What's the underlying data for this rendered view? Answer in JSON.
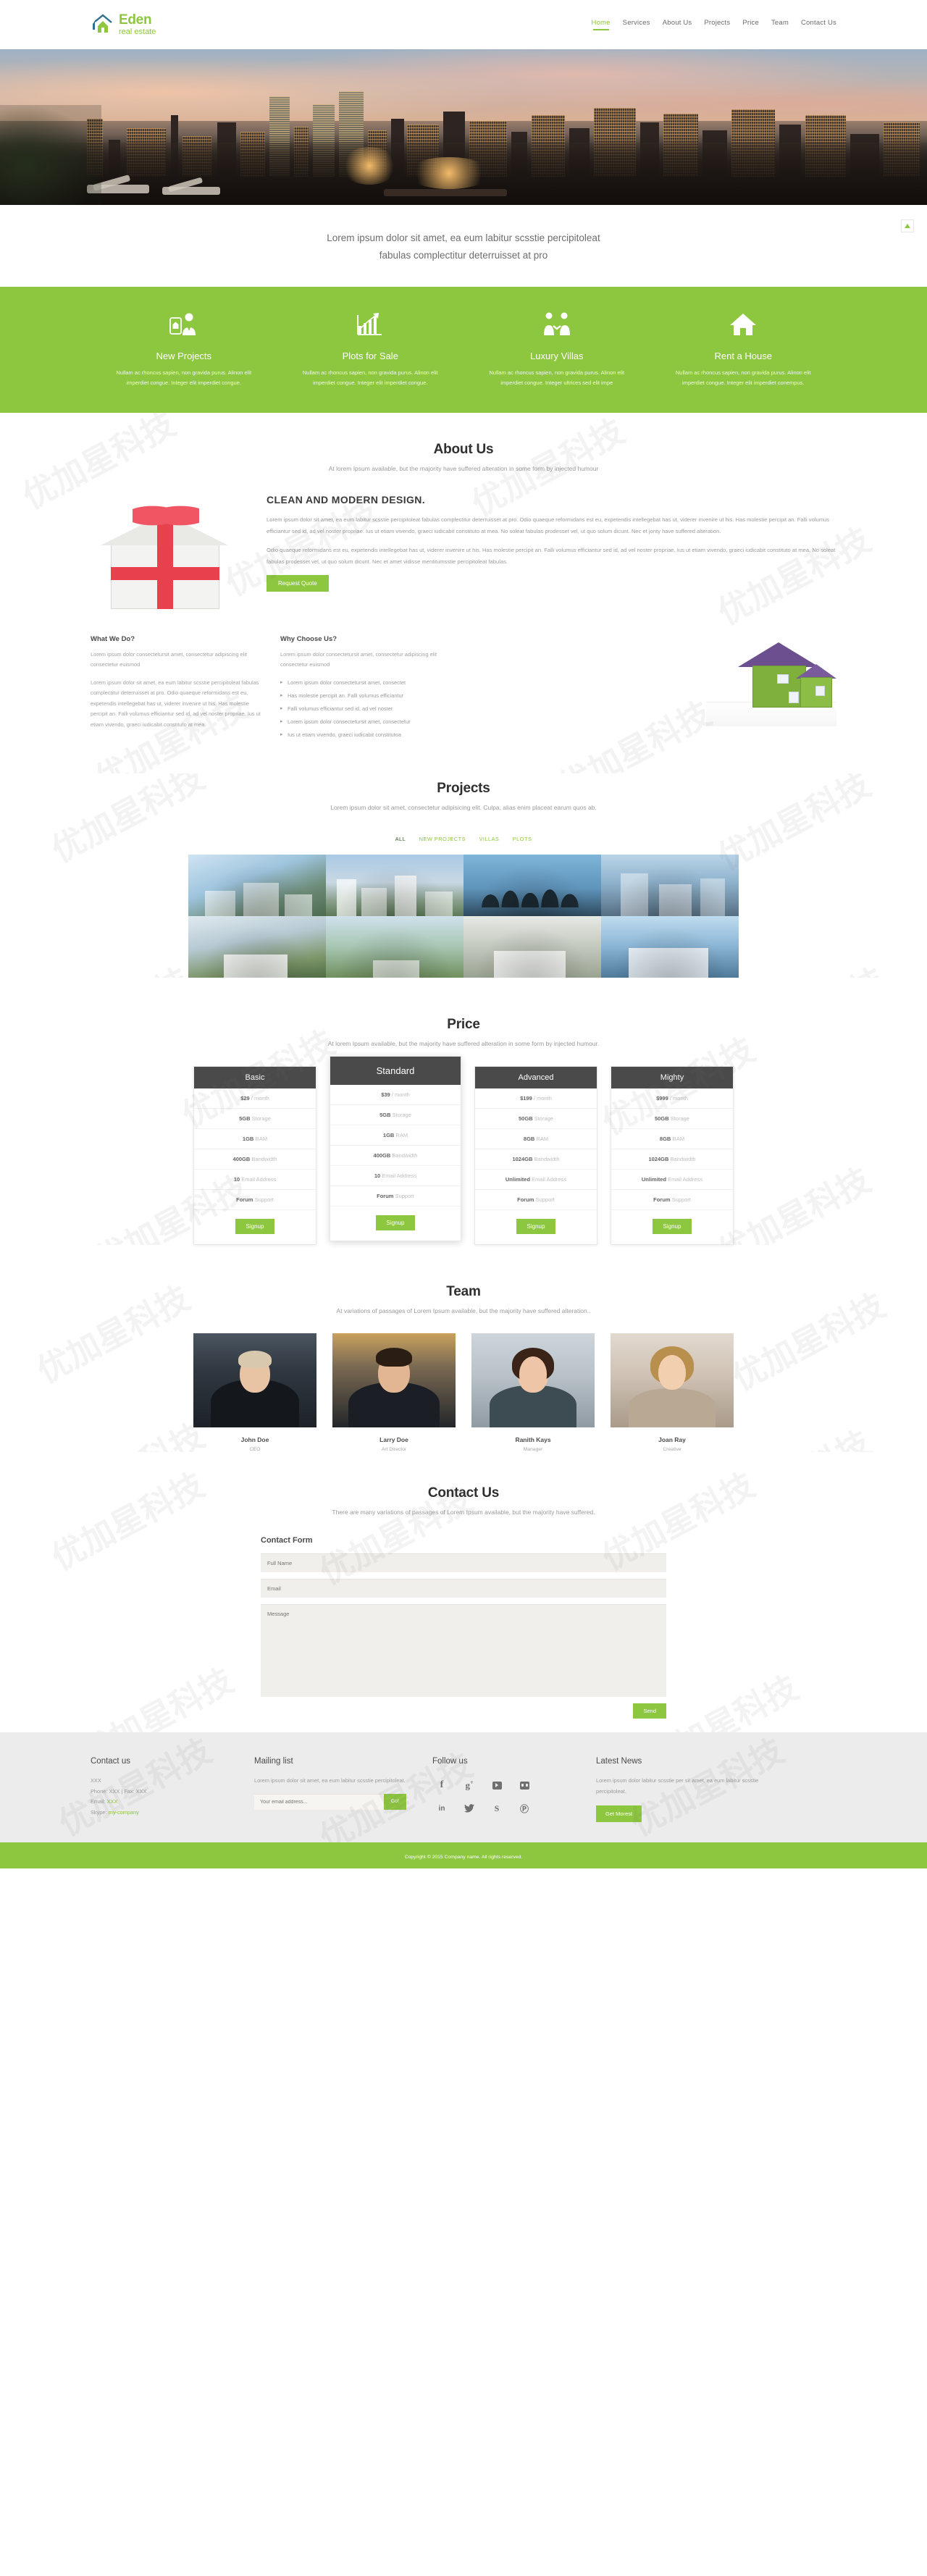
{
  "brand": {
    "name": "Eden",
    "tagline": "real estate",
    "color": "#8dc63f"
  },
  "nav": [
    {
      "label": "Home",
      "active": true
    },
    {
      "label": "Services",
      "active": false
    },
    {
      "label": "About Us",
      "active": false
    },
    {
      "label": "Projects",
      "active": false
    },
    {
      "label": "Price",
      "active": false
    },
    {
      "label": "Team",
      "active": false
    },
    {
      "label": "Contact Us",
      "active": false
    }
  ],
  "hero": {
    "alt": "city skyline at dusk seen from a rooftop terrace"
  },
  "tagline": {
    "line1": "Lorem ipsum dolor sit amet, ea eum labitur scsstie percipitoleat",
    "line2": "fabulas complectitur deterruisset at pro"
  },
  "services": [
    {
      "icon": "agent-icon",
      "title": "New Projects",
      "text": "Nullam ac rhoncus sapien, non gravida purus. Alinon elit imperdiet congue. Integer elit imperdiet congue."
    },
    {
      "icon": "chart-growth-icon",
      "title": "Plots for Sale",
      "text": "Nullam ac rhoncus sapien, non gravida purus. Alinon elit imperdiet congue. Integer elit imperdiet congue."
    },
    {
      "icon": "handshake-icon",
      "title": "Luxury Villas",
      "text": "Nullam ac rhoncus sapien, non gravida purus. Alinon elit imperdiet congue. Integer ultrices sed elit impe"
    },
    {
      "icon": "home-icon",
      "title": "Rent a House",
      "text": "Nullam ac rhoncus sapien, non gravida purus. Alinon elit imperdiet congue. Integer elit imperdiet conempus."
    }
  ],
  "about": {
    "title": "About Us",
    "subtitle": "At lorem Ipsum available, but the majority have suffered alteration in some form by injected humour",
    "heading": "CLEAN AND MODERN DESIGN.",
    "p1": "Lorem ipsum dolor sit amet, ea eum labitur scsstie percipitoleat fabulas complectitur deterruisset at pro. Odio quaeque reformidans est eu, expetendis intellegebat has ut, viderer invenire ut his. Has molestie percipit an. Falli volumus efficiantur sed id, ad vel noster propriae. Ius ut etiam vivendo, graeci iudicabit constituto at mea. No soleat fabulas prodesset vel, ut quo solum dicunt. Nec et jonty have suffered alteration.",
    "p2": "Odio quaeque reformidans est eu, expetendis intellegebat has ut, viderer invenire ut his. Has molestie percipit an. Falli volumus efficiantur sed id, ad vel noster propriae. Ius ut etiam vivendo, graeci iudicabit constituto at mea. No soleat fabulas prodesset vel, ut quo solum dicunt. Nec et amet vidisse mentitumsstie percipitoleat fabulas.",
    "cta": "Request Quote",
    "what_we_do": {
      "title": "What We Do?",
      "lead": "Lorem ipsum dolor consectetursit amet, consectetur adipiscing elit consectetur euismod",
      "body": "Lorem ipsum dolor sit amet, ea eum labitur scsstie percipitoleat fabulas complectitur deterruisset at pro. Odio quaeque reformidans est eu, expetendis intellegebat has ut, viderer invenire ut his. Has molestie percipit an. Falli volumus efficiantur sed id, ad vel noster propriae. Ius ut etiam vivendo, graeci iudicabit constituto at mea."
    },
    "why_choose": {
      "title": "Why Choose Us?",
      "lead": "Lorem ipsum dolor consectetursit amet, consectetur adipiscing elit consectetur euismod",
      "items": [
        "Lorem ipsum dolor consectetursit amet, consectet",
        "Has molestie percipit an. Falli volumus efficiantur",
        "Falli volumus efficiantur sed id, ad vel noster",
        "Lorem ipsum dolor consectetursit amet, consectetur",
        "Ius ut etiam vivendo, graeci iudicabit constitutoa"
      ]
    }
  },
  "projects": {
    "title": "Projects",
    "subtitle": "Lorem ipsum dolor sit amet, consectetur adipisicing elit. Culpa, alias enim placeat earum quos ab.",
    "filters": [
      {
        "label": "ALL",
        "active": true
      },
      {
        "label": "NEW PROJECTS",
        "active": false
      },
      {
        "label": "VILLAS",
        "active": false
      },
      {
        "label": "PLOTS",
        "active": false
      }
    ],
    "items": [
      {
        "alt": "modern white apartment complex"
      },
      {
        "alt": "city high-rise towers"
      },
      {
        "alt": "silhouette of people jumping at sunset"
      },
      {
        "alt": "glass skyscrapers"
      },
      {
        "alt": "suburban house with lawn"
      },
      {
        "alt": "green field plot"
      },
      {
        "alt": "grey suburban home"
      },
      {
        "alt": "blue siding family house"
      }
    ]
  },
  "price": {
    "title": "Price",
    "subtitle": "At lorem Ipsum available, but the majority have suffered alteration in some form by injected humour.",
    "plans": [
      {
        "name": "Basic",
        "featured": false,
        "signup": "Signup",
        "features": [
          {
            "value": "$29",
            "label": "/ month"
          },
          {
            "value": "5GB",
            "label": "Storage"
          },
          {
            "value": "1GB",
            "label": "RAM"
          },
          {
            "value": "400GB",
            "label": "Bandwidth"
          },
          {
            "value": "10",
            "label": "Email Address"
          },
          {
            "value": "Forum",
            "label": "Support"
          }
        ]
      },
      {
        "name": "Standard",
        "featured": true,
        "signup": "Signup",
        "features": [
          {
            "value": "$39",
            "label": "/ month"
          },
          {
            "value": "5GB",
            "label": "Storage"
          },
          {
            "value": "1GB",
            "label": "RAM"
          },
          {
            "value": "400GB",
            "label": "Bandwidth"
          },
          {
            "value": "10",
            "label": "Email Address"
          },
          {
            "value": "Forum",
            "label": "Support"
          }
        ]
      },
      {
        "name": "Advanced",
        "featured": false,
        "signup": "Signup",
        "features": [
          {
            "value": "$199",
            "label": "/ month"
          },
          {
            "value": "50GB",
            "label": "Storage"
          },
          {
            "value": "8GB",
            "label": "RAM"
          },
          {
            "value": "1024GB",
            "label": "Bandwidth"
          },
          {
            "value": "Unlimited",
            "label": "Email Address"
          },
          {
            "value": "Forum",
            "label": "Support"
          }
        ]
      },
      {
        "name": "Mighty",
        "featured": false,
        "signup": "Signup",
        "features": [
          {
            "value": "$999",
            "label": "/ month"
          },
          {
            "value": "50GB",
            "label": "Storage"
          },
          {
            "value": "8GB",
            "label": "RAM"
          },
          {
            "value": "1024GB",
            "label": "Bandwidth"
          },
          {
            "value": "Unlimited",
            "label": "Email Address"
          },
          {
            "value": "Forum",
            "label": "Support"
          }
        ]
      }
    ]
  },
  "team": {
    "title": "Team",
    "subtitle": "At variations of passages of Lorem Ipsum available, but the majority have suffered alteration..",
    "members": [
      {
        "name": "John Doe",
        "role": "CEO"
      },
      {
        "name": "Larry Doe",
        "role": "Art Director"
      },
      {
        "name": "Ranith Kays",
        "role": "Manager"
      },
      {
        "name": "Joan Ray",
        "role": "Creative"
      }
    ]
  },
  "contact": {
    "title": "Contact Us",
    "subtitle": "There are many variations of passages of Lorem Ipsum available, but the majority have suffered.",
    "form_title": "Contact Form",
    "fields": {
      "name_placeholder": "Full Name",
      "email_placeholder": "Email",
      "message_placeholder": "Message"
    },
    "send": "Send"
  },
  "footer": {
    "contact": {
      "title": "Contact us",
      "address": "XXX",
      "phone": "Phone: XXX  |  Fax: XXX",
      "email_label": "Email:",
      "email_value": "XXX",
      "skype_label": "Skype:",
      "skype_value": "my-company"
    },
    "mailing": {
      "title": "Mailing list",
      "text": "Lorem ipsum dolor sit amet, ea eum labitur scsstie percipitoleat.",
      "placeholder": "Your email address...",
      "button": "Go!"
    },
    "follow": {
      "title": "Follow us",
      "icons": [
        "facebook-icon",
        "google-plus-icon",
        "youtube-icon",
        "flickr-icon",
        "linkedin-icon",
        "twitter-icon",
        "skype-icon",
        "pinterest-icon"
      ],
      "glyphs": [
        "f",
        "g+",
        "▶",
        "●●",
        "in",
        "✉",
        "S",
        "Ⓟ"
      ]
    },
    "news": {
      "title": "Latest News",
      "text": "Lorem ipsum dolor labitur scsstie per sit amet, ea eum labitur scsstie percipitoleat.",
      "button": "Get Morest"
    },
    "copyright": "Copyright © 2015 Company name. All rights reserved."
  },
  "watermark": {
    "text": "优加星科技"
  }
}
